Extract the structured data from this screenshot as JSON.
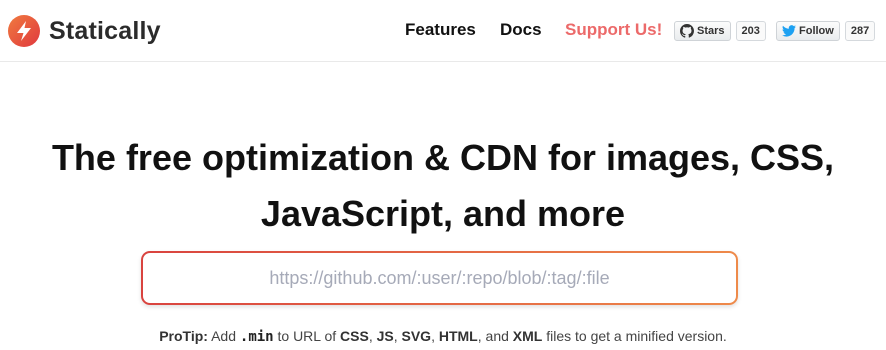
{
  "brand": {
    "name": "Statically",
    "logo_colors": [
      "#f07b3f",
      "#e0383e"
    ]
  },
  "nav": {
    "features": "Features",
    "docs": "Docs",
    "support": "Support Us!",
    "support_color": "#ec6a6a"
  },
  "social": {
    "github": {
      "label": "Stars",
      "count": "203",
      "icon": "github-icon"
    },
    "twitter": {
      "label": "Follow",
      "count": "287",
      "icon": "twitter-icon"
    }
  },
  "hero": {
    "title_line1": "The free optimization & CDN for images, CSS,",
    "title_line2": "JavaScript, and more"
  },
  "search": {
    "placeholder": "https://github.com/:user/:repo/blob/:tag/:file",
    "value": "",
    "border_gradient": [
      "#d9433f",
      "#ee8a4a"
    ]
  },
  "protip": {
    "label": "ProTip:",
    "t1": " Add ",
    "code": ".min",
    "t2": " to URL of ",
    "css": "CSS",
    "sep1": ", ",
    "js": "JS",
    "sep2": ", ",
    "svg": "SVG",
    "sep3": ", ",
    "html": "HTML",
    "sep4": ", and ",
    "xml": "XML",
    "t3": " files to get a minified version."
  }
}
